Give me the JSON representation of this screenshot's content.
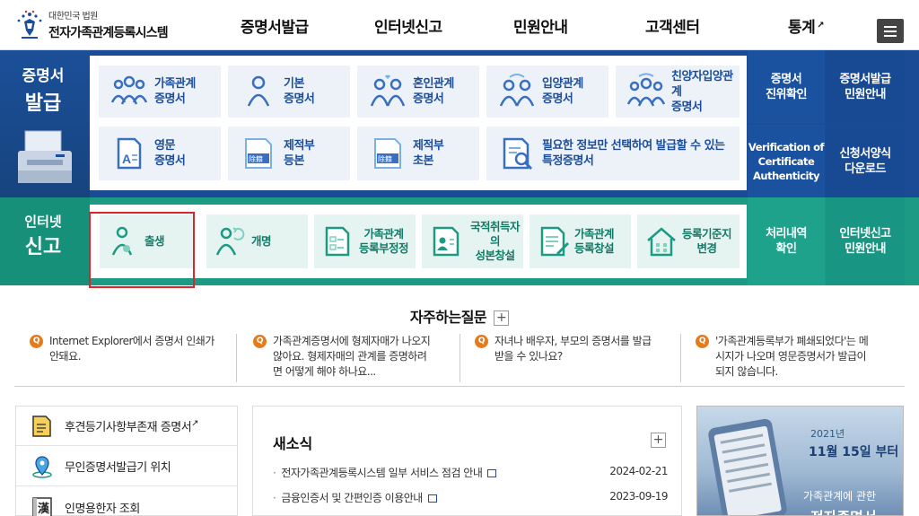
{
  "header": {
    "logo_sub": "대한민국 법원",
    "logo_main": "전자가족관계등록시스템",
    "nav": [
      "증명서발급",
      "인터넷신고",
      "민원안내",
      "고객센터",
      "통계"
    ]
  },
  "issue": {
    "title_small": "증명서",
    "title_big": "발급",
    "cards": [
      {
        "label1": "가족관계",
        "label2": "증명서",
        "icon": "family-icon"
      },
      {
        "label1": "기본",
        "label2": "증명서",
        "icon": "person-icon"
      },
      {
        "label1": "혼인관계",
        "label2": "증명서",
        "icon": "couple-heart-icon"
      },
      {
        "label1": "입양관계",
        "label2": "증명서",
        "icon": "adoption-icon"
      },
      {
        "label1": "친양자입양관계",
        "label2": "증명서",
        "icon": "full-adoption-icon"
      },
      {
        "label1": "영문",
        "label2": "증명서",
        "icon": "english-doc-icon"
      },
      {
        "label1": "제적부",
        "label2": "등본",
        "icon": "removal-doc-icon"
      },
      {
        "label1": "제적부",
        "label2": "초본",
        "icon": "removal-doc-icon"
      },
      {
        "label1": "필요한 정보만 선택하여 발급할 수 있는",
        "label2": "특정증명서",
        "icon": "search-doc-icon"
      }
    ],
    "side": [
      {
        "line1": "증명서",
        "line2": "진위확인"
      },
      {
        "line1": "증명서발급",
        "line2": "민원안내"
      },
      {
        "line1": "Verification of",
        "line2": "Certificate",
        "line3": "Authenticity"
      },
      {
        "line1": "신청서양식",
        "line2": "다운로드"
      }
    ]
  },
  "report": {
    "title_small": "인터넷",
    "title_big": "신고",
    "cards": [
      {
        "label1": "출생",
        "label2": "",
        "icon": "baby-icon"
      },
      {
        "label1": "개명",
        "label2": "",
        "icon": "rename-icon"
      },
      {
        "label1": "가족관계",
        "label2": "등록부정정",
        "icon": "form-edit-icon"
      },
      {
        "label1": "국적취득자의",
        "label2": "성본창설",
        "icon": "id-card-icon"
      },
      {
        "label1": "가족관계",
        "label2": "등록창설",
        "icon": "doc-create-icon"
      },
      {
        "label1": "등록기준지",
        "label2": "변경",
        "icon": "house-icon"
      }
    ],
    "side": [
      {
        "line1": "처리내역",
        "line2": "확인"
      },
      {
        "line1": "인터넷신고",
        "line2": "민원안내"
      }
    ]
  },
  "faq": {
    "title": "자주하는질문",
    "items": [
      {
        "l1": "Internet Explorer에서 증명서 인쇄가",
        "l2": "안돼요.",
        "l3": ""
      },
      {
        "l1": "가족관계증명서에 형제자매가 나오지",
        "l2": "않아요. 형제자매의 관계를 증명하려",
        "l3": "면 어떻게 해야 하나요..."
      },
      {
        "l1": "자녀나 배우자, 부모의 증명서를 발급",
        "l2": "받을 수 있나요?",
        "l3": ""
      },
      {
        "l1": "'가족관계등록부가 폐쇄되었다'는 메",
        "l2": "시지가 나오며 영문증명서가 발급이",
        "l3": "되지 않습니다."
      }
    ]
  },
  "quick": [
    {
      "label": "후견등기사항부존재 증명서",
      "icon": "document-icon",
      "ext": true
    },
    {
      "label": "무인증명서발급기 위치",
      "icon": "location-pin-icon",
      "ext": false
    },
    {
      "label": "인명용한자 조회",
      "icon": "hanja-book-icon",
      "ext": false
    }
  ],
  "news": {
    "title": "새소식",
    "rows": [
      {
        "text": "전자가족관계등록시스템 일부 서비스 점검 안내",
        "date": "2024-02-21"
      },
      {
        "text": "금융인증서 및 간편인증 이용안내",
        "date": "2023-09-19"
      }
    ]
  },
  "banner": {
    "year": "2021년",
    "date": "11월 15일 부터",
    "sub": "가족관계에 관한",
    "big": "전자증명서"
  }
}
